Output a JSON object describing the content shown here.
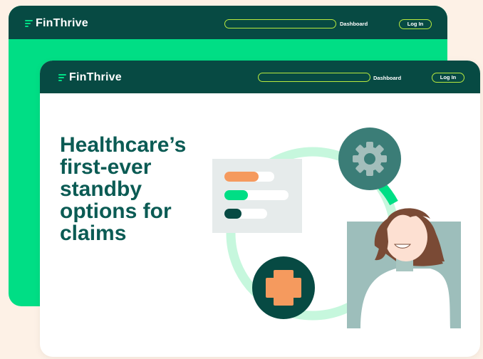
{
  "back_window": {
    "logo": "FinThrive",
    "nav_dashboard": "Dashboard",
    "login": "Log In"
  },
  "front_window": {
    "logo": "FinThrive",
    "nav_dashboard": "Dashboard",
    "login": "Log In",
    "headline": "Healthcare’s first-ever standby options for claims"
  },
  "colors": {
    "brand_green": "#00de85",
    "dark_teal": "#074a43",
    "headline_teal": "#0b5b54",
    "accent_lime": "#b8ea3f",
    "orange": "#f59a5e",
    "background": "#fdf1e6"
  },
  "icons": [
    "gear-icon",
    "plus-icon",
    "list-card-icon",
    "person-avatar"
  ],
  "list_card_bars": [
    {
      "color": "#f59a5e",
      "fill": 0.68
    },
    {
      "color": "#00de85",
      "fill": 0.35
    },
    {
      "color": "#074a43",
      "fill": 0.4
    }
  ]
}
